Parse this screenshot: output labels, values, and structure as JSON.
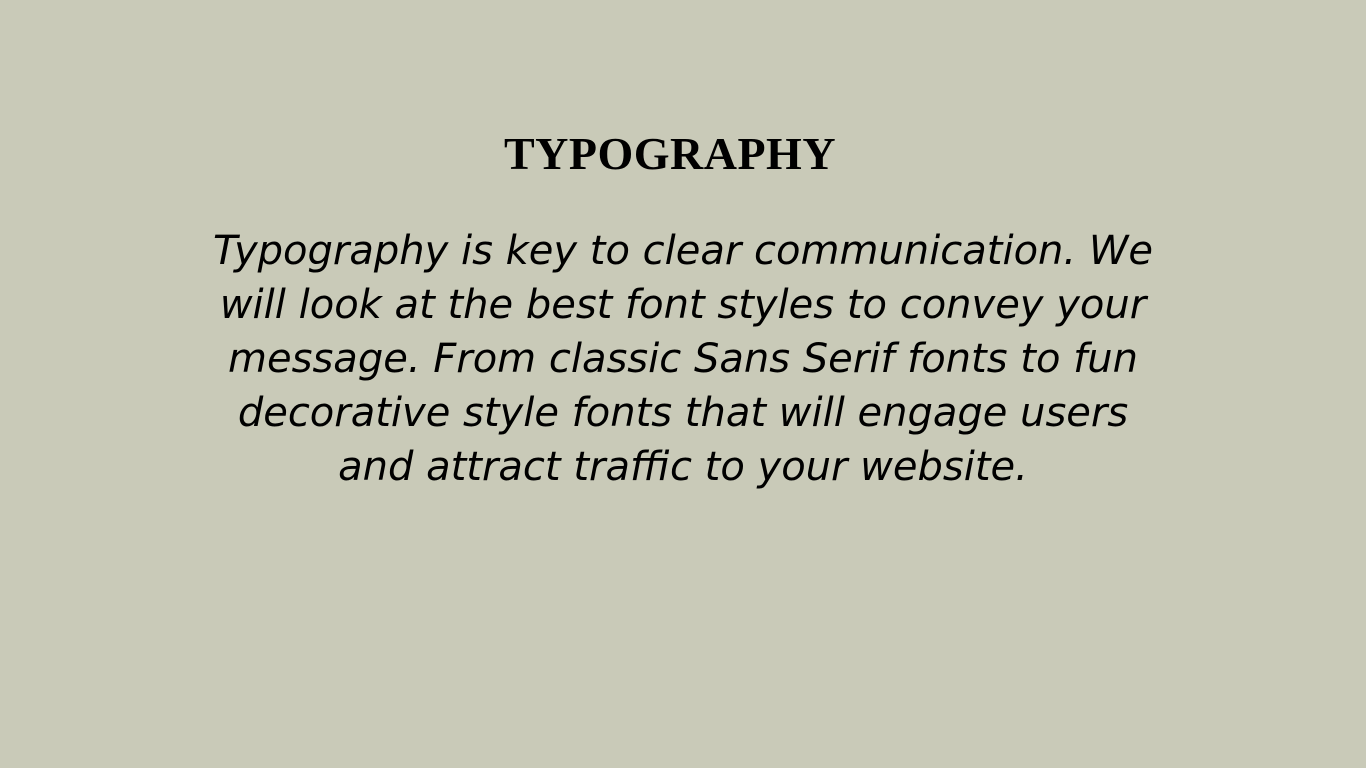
{
  "colors": {
    "background": "#c9cab8",
    "text": "#000000"
  },
  "slide": {
    "title": "TYPOGRAPHY",
    "body_lines": [
      "Typography is key to clear communication. We",
      "will look at the best font styles to convey your",
      "message. From classic Sans Serif fonts to fun",
      "decorative style fonts that will engage users",
      "and attract traffic to your website."
    ]
  }
}
